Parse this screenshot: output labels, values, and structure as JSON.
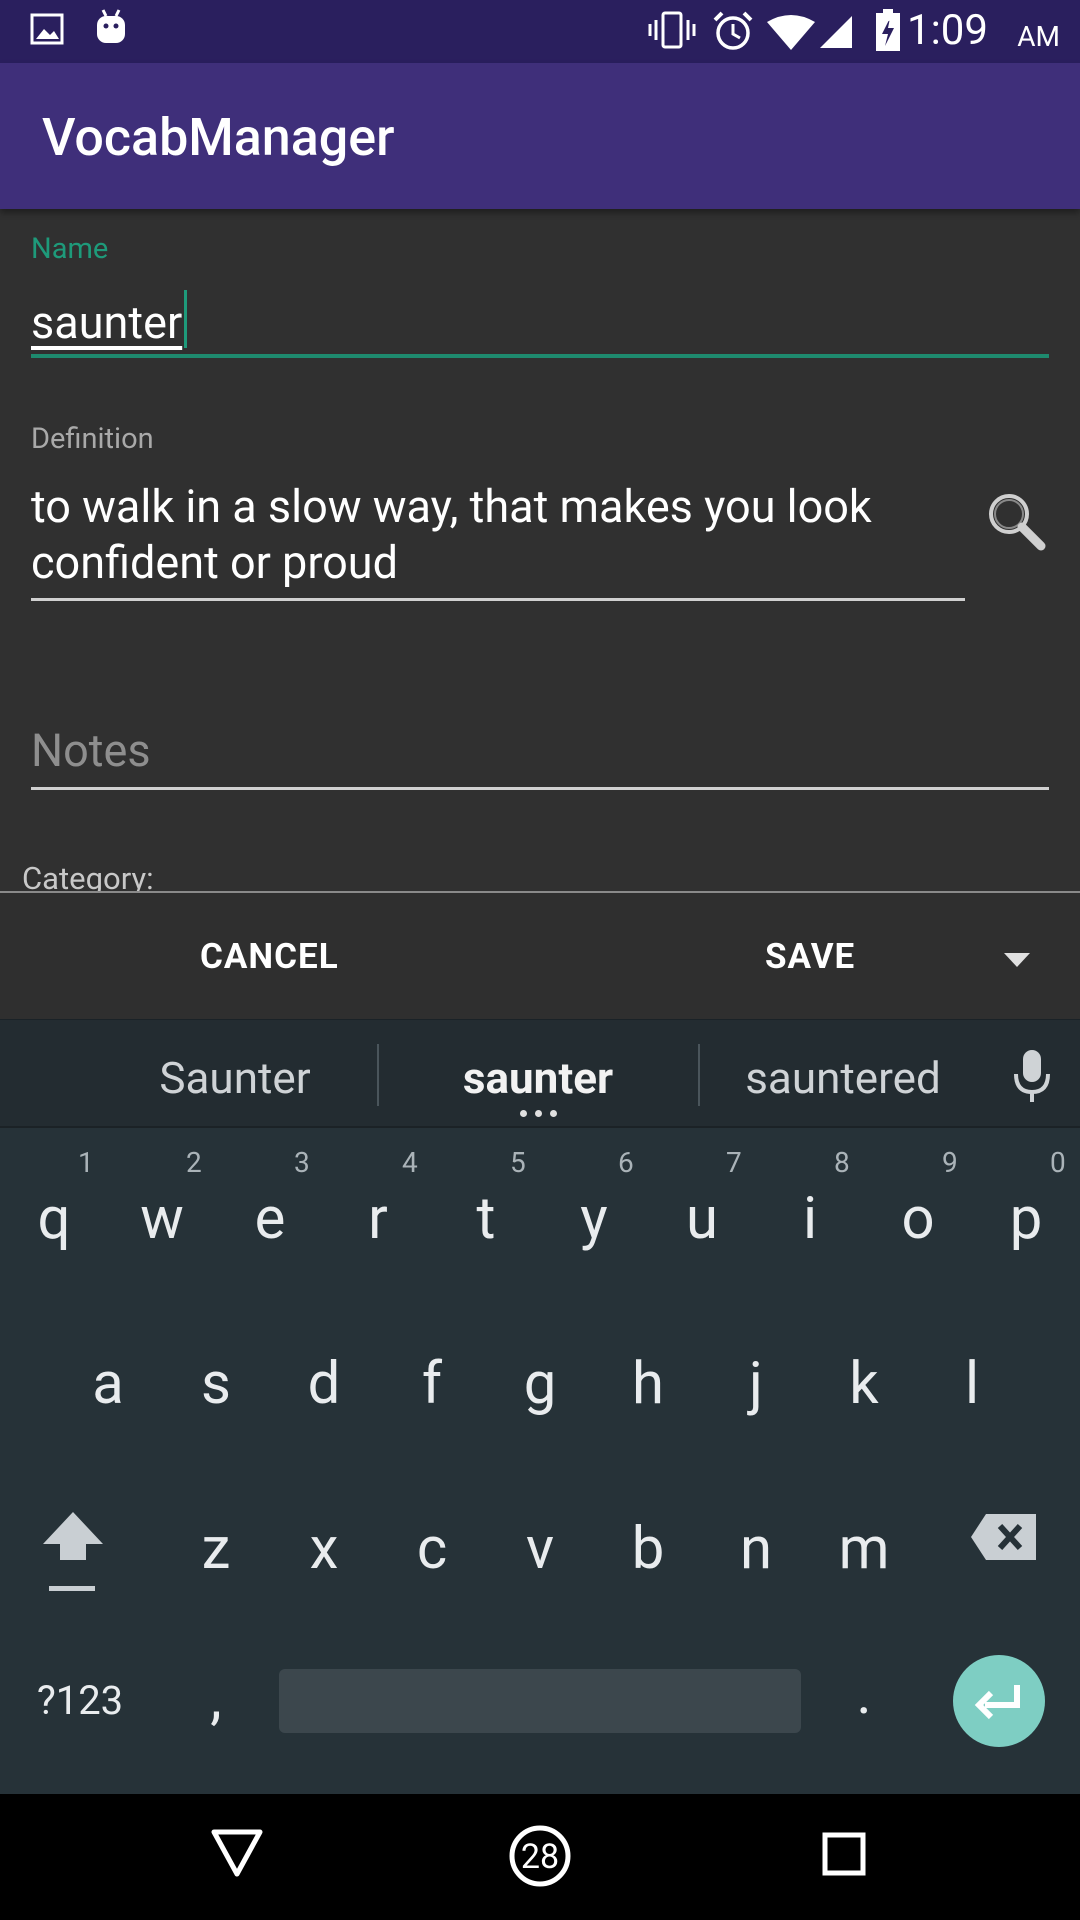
{
  "status_bar": {
    "time": "11:09",
    "ampm": "AM",
    "icons": [
      "image-icon",
      "android-icon",
      "vibrate-icon",
      "alarm-icon",
      "wifi-icon",
      "signal-icon",
      "battery-icon"
    ]
  },
  "app": {
    "title": "VocabManager"
  },
  "form": {
    "name_label": "Name",
    "name_value": "saunter",
    "definition_label": "Definition",
    "definition_value": "to walk in a slow way, that makes you look confident or proud",
    "notes_placeholder": "Notes",
    "category_label": "Category:"
  },
  "dialog_buttons": {
    "cancel": "CANCEL",
    "save": "SAVE"
  },
  "keyboard": {
    "suggestions": [
      "Saunter",
      "saunter",
      "sauntered"
    ],
    "row1": [
      "q",
      "w",
      "e",
      "r",
      "t",
      "y",
      "u",
      "i",
      "o",
      "p"
    ],
    "row1_hints": [
      "1",
      "2",
      "3",
      "4",
      "5",
      "6",
      "7",
      "8",
      "9",
      "0"
    ],
    "row2": [
      "a",
      "s",
      "d",
      "f",
      "g",
      "h",
      "j",
      "k",
      "l"
    ],
    "row3": [
      "z",
      "x",
      "c",
      "v",
      "b",
      "n",
      "m"
    ],
    "symbols_key": "?123",
    "comma_key": ",",
    "period_key": "."
  },
  "nav_bar": {
    "home_badge": "28"
  },
  "colors": {
    "status_bar": "#2a1f5e",
    "app_bar": "#3f2f7a",
    "accent": "#1e8a6e",
    "background": "#303030",
    "keyboard": "#263238",
    "enter_key": "#7ecec3"
  }
}
